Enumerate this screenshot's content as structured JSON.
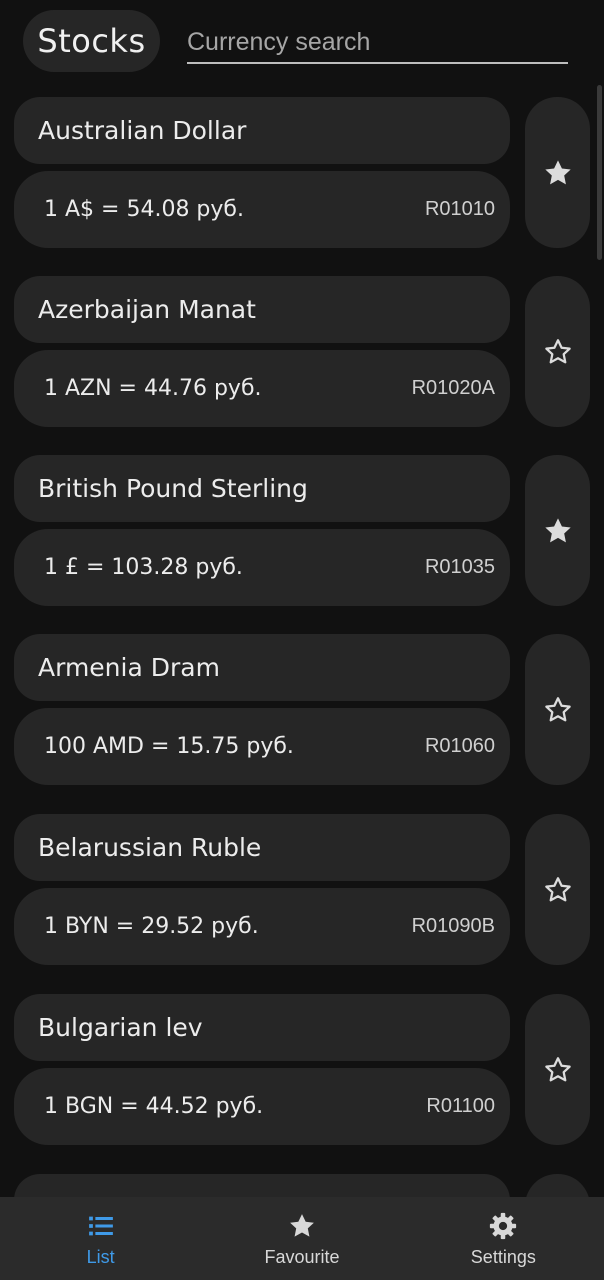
{
  "header": {
    "title": "Stocks",
    "search_placeholder": "Currency search"
  },
  "currencies": [
    {
      "name": "Australian Dollar",
      "rate": "1 A$ = 54.08 руб.",
      "code": "R01010",
      "favourite": true,
      "icon": "star-filled-icon"
    },
    {
      "name": "Azerbaijan Manat",
      "rate": "1 AZN = 44.76 руб.",
      "code": "R01020A",
      "favourite": false,
      "icon": "star-outline-icon"
    },
    {
      "name": "British Pound Sterling",
      "rate": "1 £ = 103.28 руб.",
      "code": "R01035",
      "favourite": true,
      "icon": "star-filled-icon"
    },
    {
      "name": "Armenia Dram",
      "rate": "100 AMD = 15.75 руб.",
      "code": "R01060",
      "favourite": false,
      "icon": "star-outline-icon"
    },
    {
      "name": "Belarussian Ruble",
      "rate": "1 BYN = 29.52 руб.",
      "code": "R01090B",
      "favourite": false,
      "icon": "star-outline-icon"
    },
    {
      "name": "Bulgarian lev",
      "rate": "1 BGN = 44.52 руб.",
      "code": "R01100",
      "favourite": false,
      "icon": "star-outline-icon"
    }
  ],
  "bottom_nav": [
    {
      "label": "List",
      "icon": "list-icon",
      "active": true
    },
    {
      "label": "Favourite",
      "icon": "star-icon",
      "active": false
    },
    {
      "label": "Settings",
      "icon": "gear-icon",
      "active": false
    }
  ],
  "colors": {
    "background": "#111111",
    "card": "#262626",
    "nav_background": "#2b2b2b",
    "accent": "#3f9ae8",
    "text": "#ececec"
  }
}
